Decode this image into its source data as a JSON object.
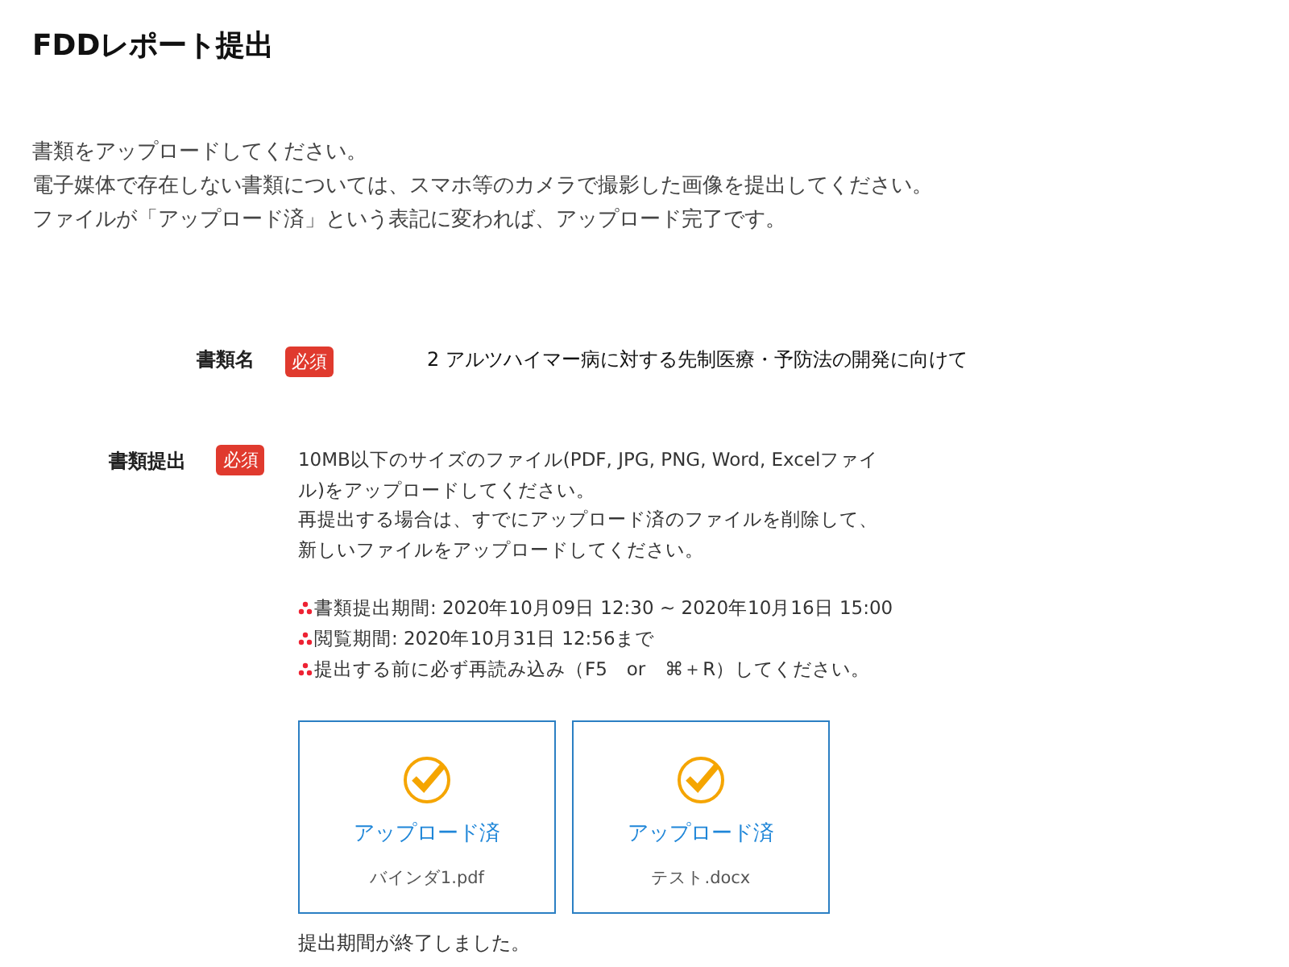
{
  "title": "FDDレポート提出",
  "intro": [
    "書類をアップロードしてください。",
    "電子媒体で存在しない書類については、スマホ等のカメラで撮影した画像を提出してください。",
    "ファイルが「アップロード済」という表記に変われば、アップロード完了です。"
  ],
  "fields": [
    {
      "kind": "text",
      "label": "書類名",
      "badge": "必須",
      "value": "2 アルツハイマー病に対する先制医療・予防法の開発に向けて"
    },
    {
      "kind": "upload",
      "label": "書類提出",
      "badge": "必須",
      "instructions": [
        "10MB以下のサイズのファイル(PDF, JPG, PNG, Word, Excelファイル)をアップロードしてください。",
        "再提出する場合は、すでにアップロード済のファイルを削除して、新しいファイルをアップロードしてください。"
      ],
      "notes": [
        "書類提出期間: 2020年10月09日 12:30 ~ 2020年10月16日 15:00",
        "閲覧期間: 2020年10月31日 12:56まで",
        "提出する前に必ず再読み込み（F5　or　⌘＋R）してください。"
      ],
      "files": [
        {
          "status": "アップロード済",
          "name": "バインダ1.pdf"
        },
        {
          "status": "アップロード済",
          "name": "テスト.docx"
        }
      ],
      "footer": "提出期間が終了しました。"
    }
  ]
}
